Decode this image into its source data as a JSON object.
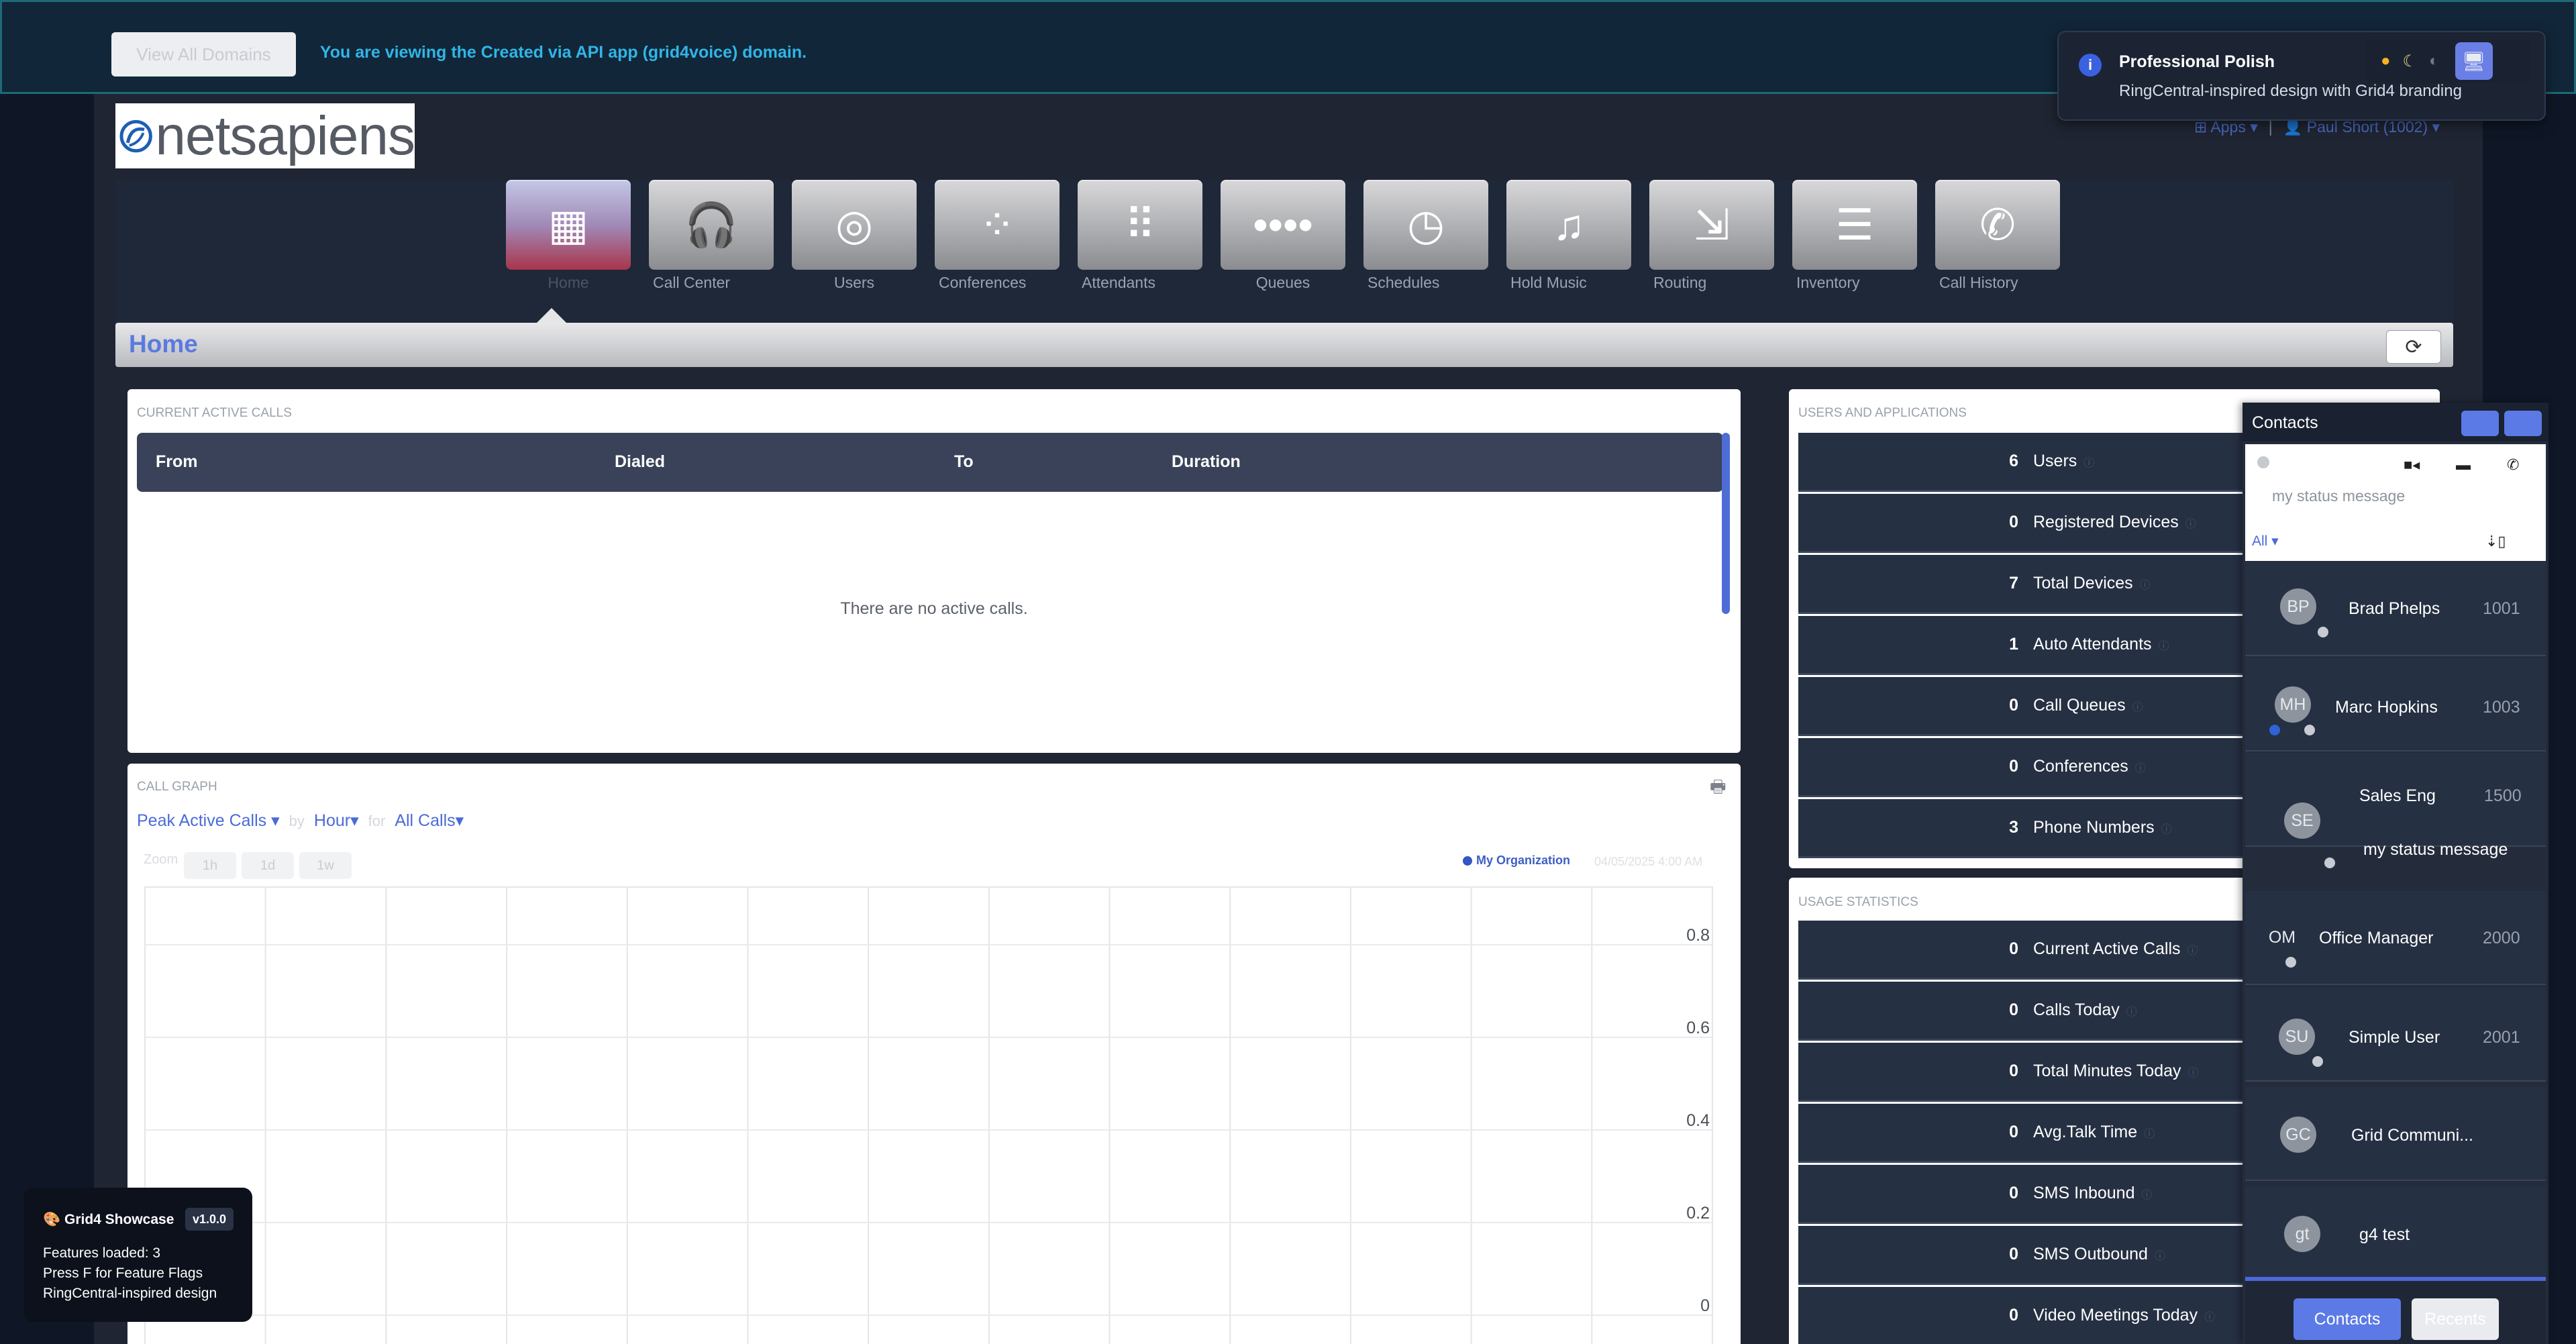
{
  "banner": {
    "button_label": "View All Domains",
    "message": "You are viewing the Created via API app (grid4voice) domain."
  },
  "header": {
    "logo_text": "netsapiens",
    "apps_label": "Apps",
    "user_label": "Paul Short (1002)"
  },
  "nav": {
    "items": [
      {
        "label": "Home",
        "icon": "building-icon"
      },
      {
        "label": "Call Center",
        "icon": "headset-icon"
      },
      {
        "label": "Users",
        "icon": "users-icon"
      },
      {
        "label": "Conferences",
        "icon": "conference-icon"
      },
      {
        "label": "Attendants",
        "icon": "keypad-icon"
      },
      {
        "label": "Queues",
        "icon": "queue-icon"
      },
      {
        "label": "Schedules",
        "icon": "clock-icon"
      },
      {
        "label": "Hold Music",
        "icon": "music-icon"
      },
      {
        "label": "Routing",
        "icon": "routing-icon"
      },
      {
        "label": "Inventory",
        "icon": "inventory-icon"
      },
      {
        "label": "Call History",
        "icon": "phone-history-icon"
      }
    ]
  },
  "page": {
    "title": "Home"
  },
  "active_calls": {
    "title": "CURRENT ACTIVE CALLS",
    "columns": [
      "From",
      "Dialed",
      "To",
      "Duration"
    ],
    "empty_text": "There are no active calls."
  },
  "call_graph": {
    "title": "CALL GRAPH",
    "metric": "Peak Active Calls",
    "by_label": "by",
    "interval": "Hour",
    "for_label": "for",
    "call_type": "All Calls",
    "zoom_label": "Zoom",
    "zoom_buttons": [
      "1h",
      "1d",
      "1w"
    ],
    "legend": "My Organization",
    "legend_date": "04/05/2025 4:00 AM"
  },
  "chart_data": {
    "type": "line",
    "title": "",
    "xlabel": "",
    "ylabel": "",
    "ylim": [
      0,
      1
    ],
    "y_ticks": [
      "0.8",
      "0.6",
      "0.4",
      "0.2",
      "0"
    ],
    "grid": true,
    "series": [
      {
        "name": "My Organization",
        "values": []
      }
    ]
  },
  "users_apps": {
    "title": "USERS AND APPLICATIONS",
    "rows": [
      {
        "value": "6",
        "label": "Users"
      },
      {
        "value": "0",
        "label": "Registered Devices"
      },
      {
        "value": "7",
        "label": "Total Devices"
      },
      {
        "value": "1",
        "label": "Auto Attendants"
      },
      {
        "value": "0",
        "label": "Call Queues"
      },
      {
        "value": "0",
        "label": "Conferences"
      },
      {
        "value": "3",
        "label": "Phone Numbers"
      }
    ]
  },
  "usage": {
    "title": "USAGE STATISTICS",
    "rows": [
      {
        "value": "0",
        "label": "Current Active Calls"
      },
      {
        "value": "0",
        "label": "Calls Today"
      },
      {
        "value": "0",
        "label": "Total Minutes Today"
      },
      {
        "value": "0",
        "label": "Avg.Talk Time"
      },
      {
        "value": "0",
        "label": "SMS Inbound"
      },
      {
        "value": "0",
        "label": "SMS Outbound"
      },
      {
        "value": "0",
        "label": "Video Meetings Today"
      }
    ]
  },
  "contacts": {
    "title": "Contacts",
    "status_message": "my status message",
    "filter": "All",
    "list": [
      {
        "initials": "BP",
        "name": "Brad Phelps",
        "ext": "1001",
        "message": ""
      },
      {
        "initials": "MH",
        "name": "Marc Hopkins",
        "ext": "1003",
        "message": ""
      },
      {
        "initials": "SE",
        "name": "Sales Eng",
        "ext": "1500",
        "message": "my status message"
      },
      {
        "initials": "OM",
        "name": "Office Manager",
        "ext": "2000",
        "message": ""
      },
      {
        "initials": "SU",
        "name": "Simple User",
        "ext": "2001",
        "message": ""
      },
      {
        "initials": "GC",
        "name": "Grid Communi...",
        "ext": "",
        "message": ""
      },
      {
        "initials": "gt",
        "name": "g4 test",
        "ext": "",
        "message": ""
      }
    ],
    "tabs": [
      "Contacts",
      "Recents"
    ]
  },
  "toast": {
    "title": "Professional Polish",
    "body": "RingCentral-inspired design with Grid4 branding"
  },
  "showcase": {
    "title": "Grid4 Showcase",
    "version": "v1.0.0",
    "lines": [
      "Features loaded: 3",
      "Press F for Feature Flags",
      "RingCentral-inspired design"
    ]
  },
  "colors": {
    "accent": "#5b7ae6",
    "banner_text": "#31b5e6",
    "dark_panel": "#263043",
    "header_dark": "#394258"
  }
}
